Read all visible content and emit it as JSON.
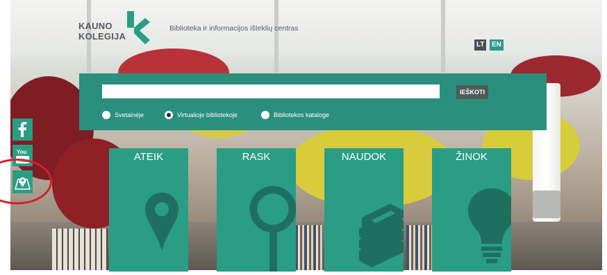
{
  "header": {
    "logo_line1": "KAUNO",
    "logo_line2": "KOLEGIJA",
    "subtitle": "Biblioteka ir informacijos išteklių centras",
    "languages": [
      "LT",
      "EN"
    ]
  },
  "search": {
    "value": "",
    "placeholder": "",
    "button_label": "IEŠKOTI",
    "scopes": [
      {
        "label": "Svetainėje",
        "checked": false
      },
      {
        "label": "Virtualioje bibliotekoje",
        "checked": true
      },
      {
        "label": "Bibliotekos kataloge",
        "checked": false
      }
    ]
  },
  "tiles": [
    {
      "label": "ATEIK",
      "icon": "map-pin-icon"
    },
    {
      "label": "RASK",
      "icon": "magnifier-icon"
    },
    {
      "label": "NAUDOK",
      "icon": "book-stack-icon"
    },
    {
      "label": "ŽINOK",
      "icon": "lightbulb-icon"
    }
  ],
  "social": [
    {
      "icon": "facebook-icon"
    },
    {
      "icon": "youtube-icon"
    },
    {
      "icon": "map-icon"
    }
  ],
  "colors": {
    "accent": "#2a9d85",
    "panel": "#2a8f7c",
    "highlight_ring": "#d4212a",
    "button": "#4f5a58"
  }
}
